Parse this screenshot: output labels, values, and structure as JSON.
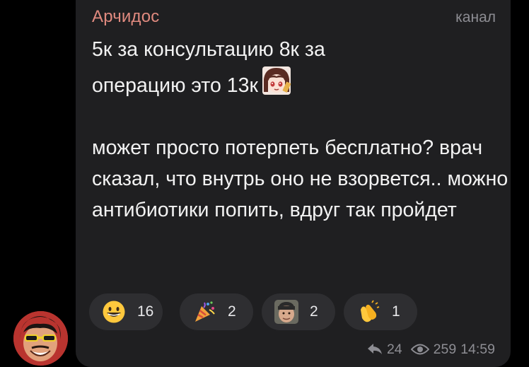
{
  "message": {
    "sender_name": "Арчидос",
    "channel_label": "канал",
    "paragraphs": [
      "5к за консультацию 8к за операцию это 13к",
      "может просто потерпеть бесплатно? врач сказал, что внутрь оно не взорвется.. можно антибиотики попить,  вдруг так пройдет"
    ],
    "line1": "5к за консультацию 8к за",
    "line2": "операцию это 13к",
    "sticker_icon": "anime-girl-emoji-icon"
  },
  "reactions": [
    {
      "icon": "grinning-face-emoji-icon",
      "count": "16"
    },
    {
      "icon": "party-popper-emoji-icon",
      "count": "2"
    },
    {
      "icon": "custom-face-emoji-icon",
      "count": "2"
    },
    {
      "icon": "clapping-hands-emoji-icon",
      "count": "1"
    }
  ],
  "footer": {
    "forwards": "24",
    "views": "259",
    "time": "14:59"
  },
  "colors": {
    "sender": "#e08a7f",
    "bubble": "#1f1f21",
    "text": "#f2f2f2",
    "muted": "#8d8d93",
    "reaction_bg": "#2e2e31"
  }
}
